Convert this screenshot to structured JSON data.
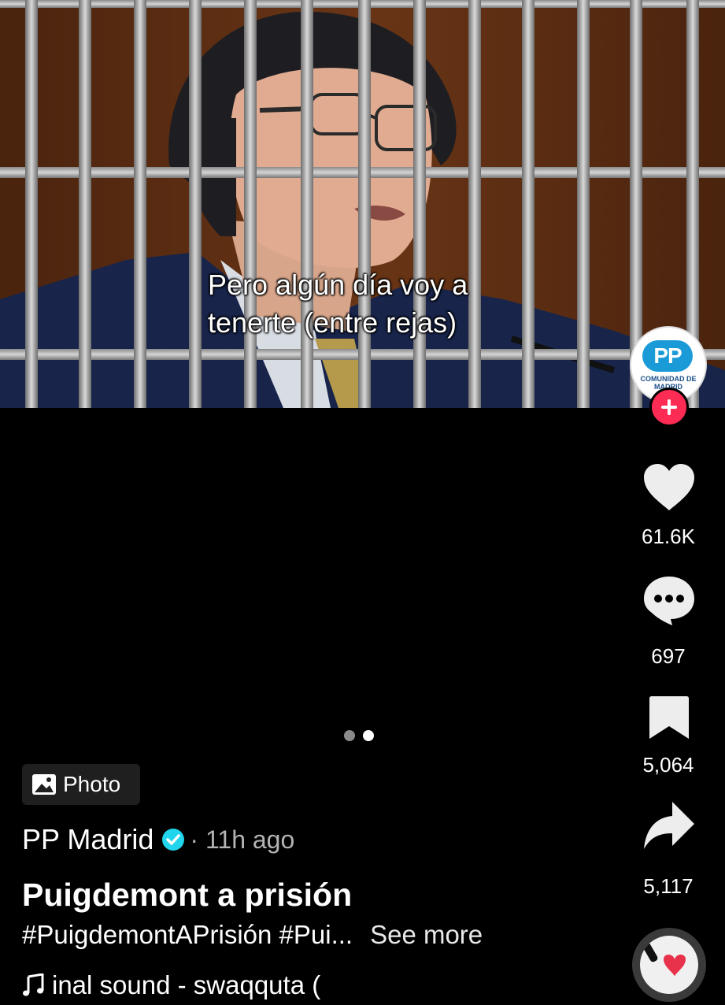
{
  "post": {
    "caption_line1": "Pero algún día voy a",
    "caption_line2": "tenerte (entre rejas)",
    "image_subject": "man behind prison bars"
  },
  "creator": {
    "avatar_logo": "PP",
    "avatar_subtext": "COMUNIDAD DE MADRID",
    "follow_icon": "plus-icon"
  },
  "actions": {
    "likes": "61.6K",
    "comments": "697",
    "saves": "5,064",
    "shares": "5,117"
  },
  "carousel": {
    "count": 2,
    "active_index": 1,
    "colors": {
      "inactive": "#8a8a8a",
      "active": "#ffffff"
    }
  },
  "badge": {
    "label": "Photo",
    "icon": "photo-icon"
  },
  "meta": {
    "author": "PP Madrid",
    "verified_icon": "verified-badge-icon",
    "time": "· 11h ago",
    "title": "Puigdemont a prisión",
    "hashtags": "#PuigdemontAPrisión #Pui...",
    "see_more": "See more",
    "sound": "inal sound - swaqquta (",
    "sound_icon": "music-note-icon"
  },
  "colors": {
    "background": "#000000",
    "follow": "#fe2c55",
    "verified": "#20d5ec",
    "pp_blue": "#1a9bd7"
  }
}
